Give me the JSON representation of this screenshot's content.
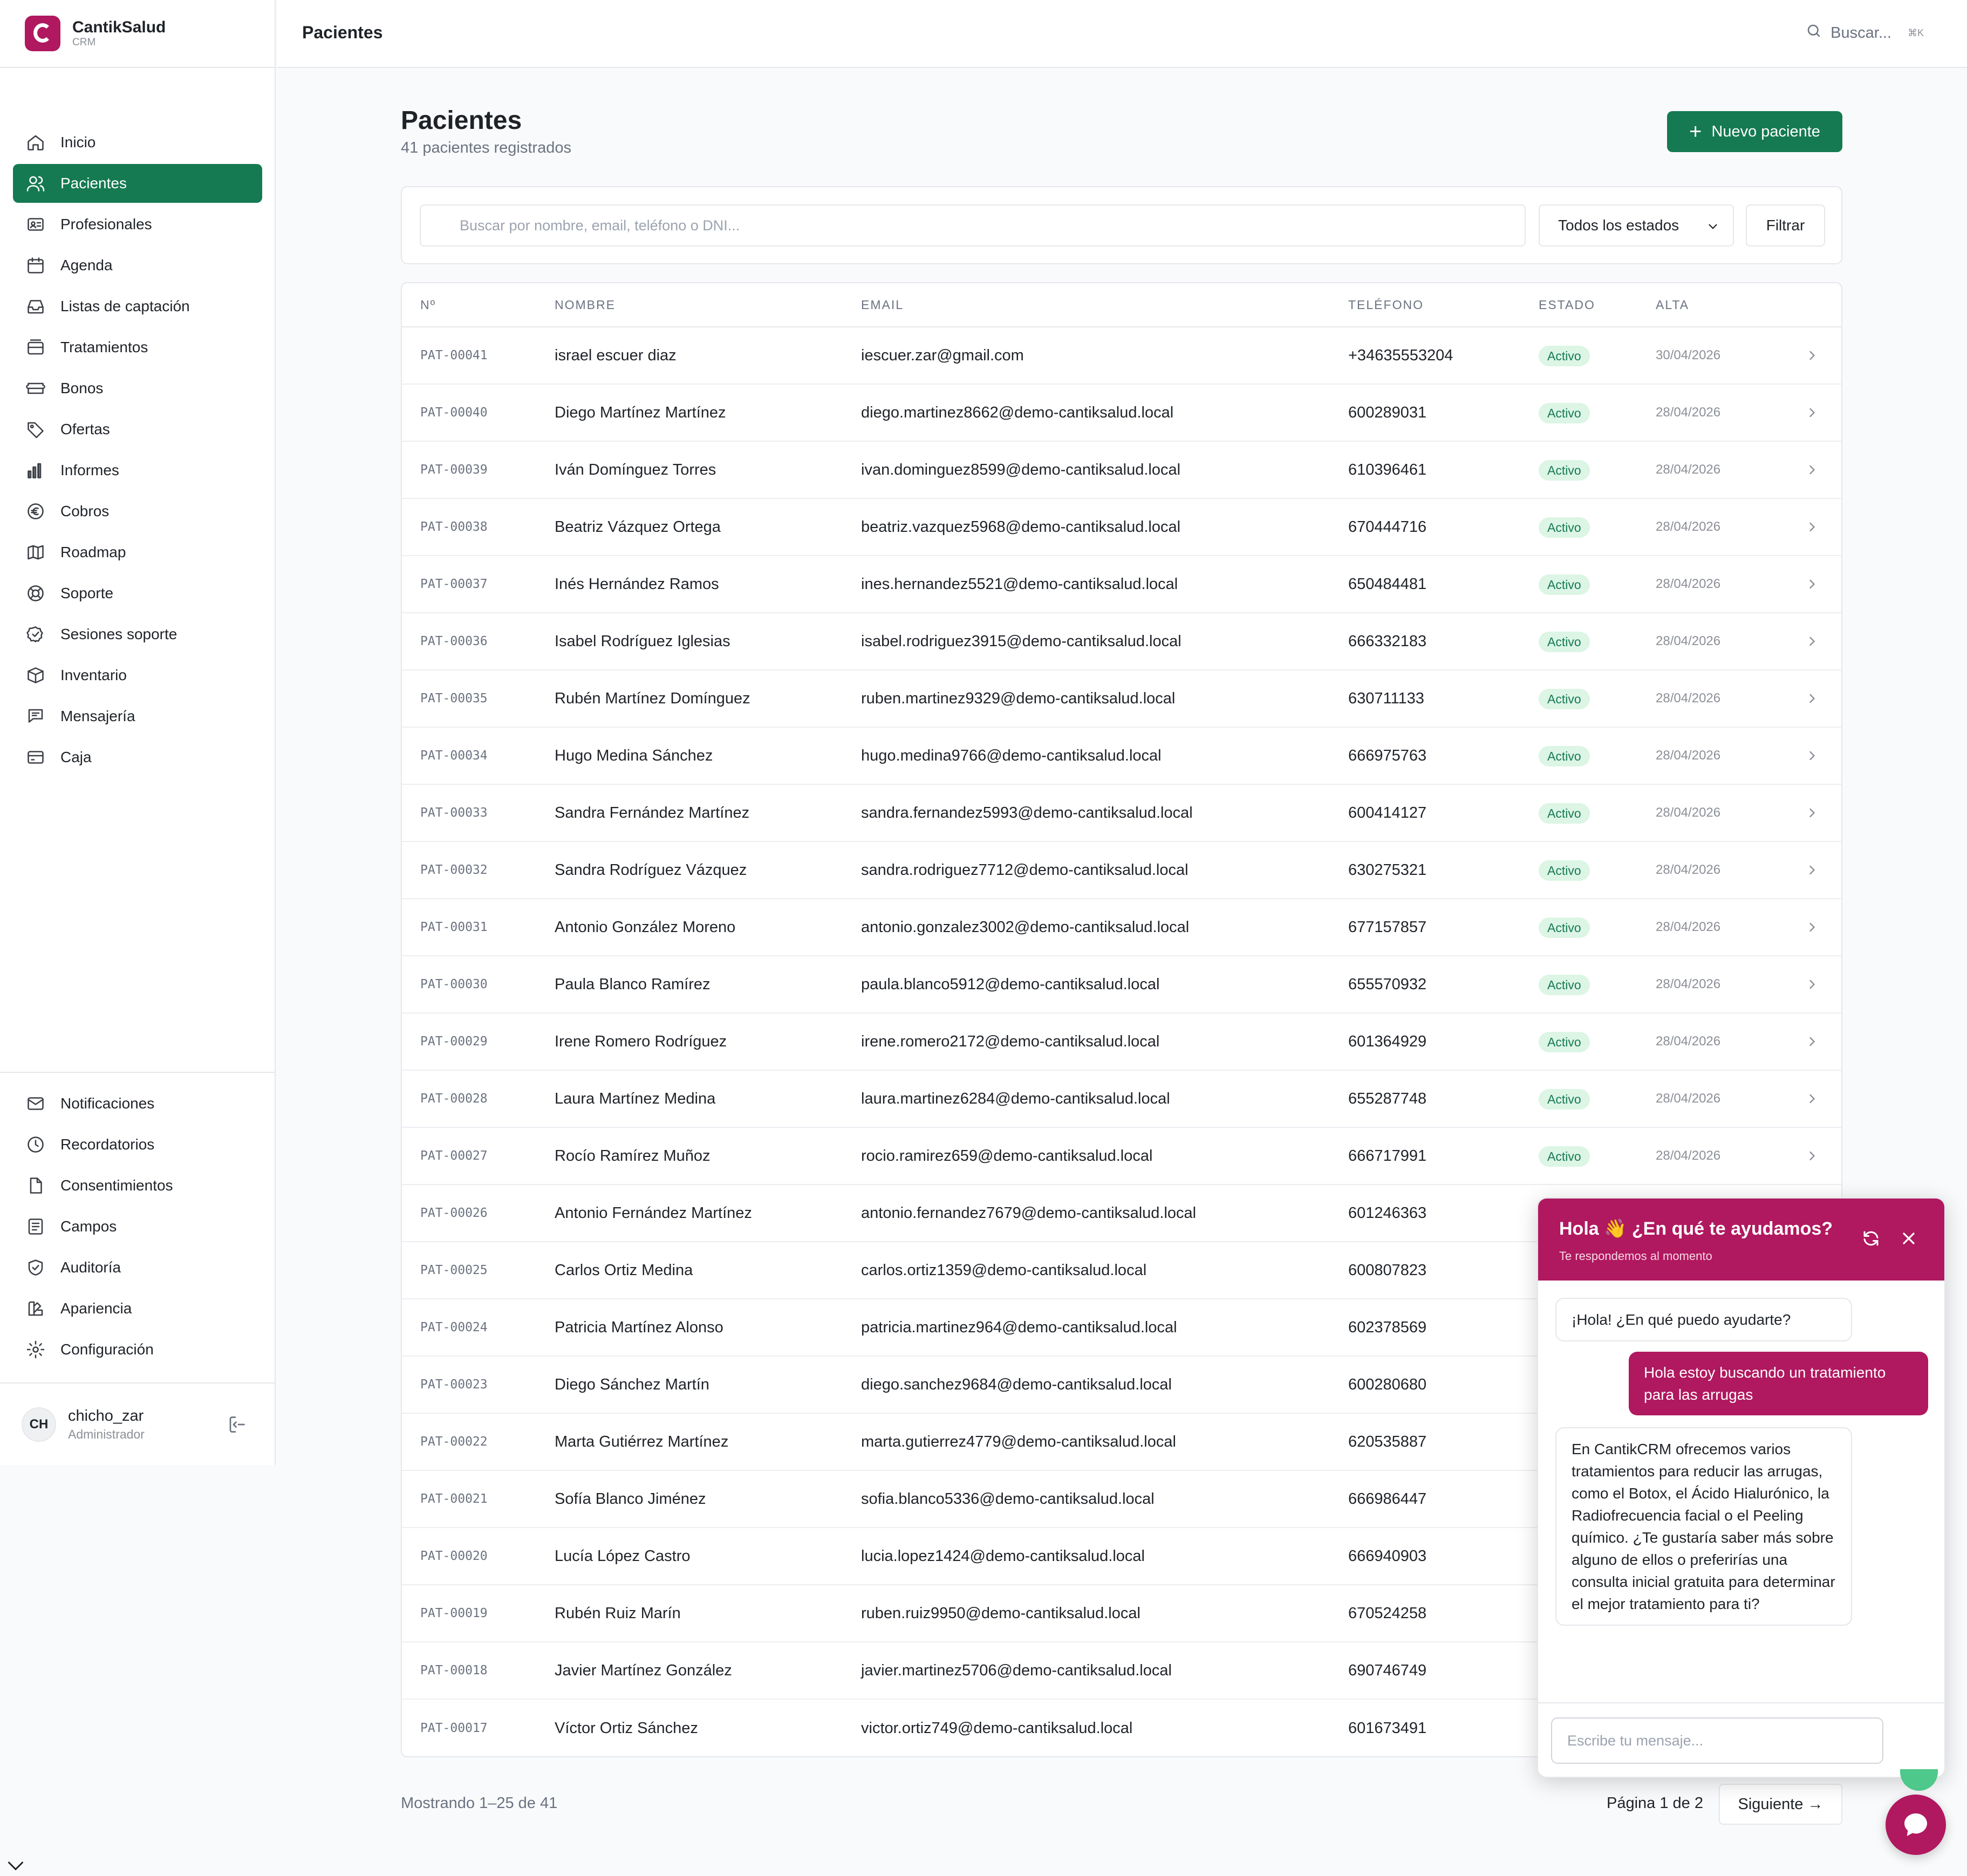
{
  "brand": {
    "name": "CantikSalud",
    "sub": "CRM",
    "color": "#b0185f"
  },
  "topbar": {
    "title": "Pacientes",
    "search_label": "Buscar...",
    "shortcut": "⌘K"
  },
  "nav": [
    {
      "label": "Inicio",
      "icon": "home-icon"
    },
    {
      "label": "Pacientes",
      "icon": "users-icon",
      "active": true
    },
    {
      "label": "Profesionales",
      "icon": "id-card-icon"
    },
    {
      "label": "Agenda",
      "icon": "calendar-icon"
    },
    {
      "label": "Listas de captación",
      "icon": "inbox-icon"
    },
    {
      "label": "Tratamientos",
      "icon": "layers-icon"
    },
    {
      "label": "Bonos",
      "icon": "ticket-icon"
    },
    {
      "label": "Ofertas",
      "icon": "tag-icon"
    },
    {
      "label": "Informes",
      "icon": "bar-chart-icon"
    },
    {
      "label": "Cobros",
      "icon": "euro-icon"
    },
    {
      "label": "Roadmap",
      "icon": "map-icon"
    },
    {
      "label": "Soporte",
      "icon": "lifebuoy-icon"
    },
    {
      "label": "Sesiones soporte",
      "icon": "badge-check-icon"
    },
    {
      "label": "Inventario",
      "icon": "box-icon"
    },
    {
      "label": "Mensajería",
      "icon": "chat-icon"
    },
    {
      "label": "Caja",
      "icon": "wallet-icon"
    }
  ],
  "bottom_nav": [
    {
      "label": "Notificaciones",
      "icon": "mail-icon"
    },
    {
      "label": "Recordatorios",
      "icon": "clock-icon"
    },
    {
      "label": "Consentimientos",
      "icon": "file-icon"
    },
    {
      "label": "Campos",
      "icon": "form-icon"
    },
    {
      "label": "Auditoría",
      "icon": "shield-check-icon"
    },
    {
      "label": "Apariencia",
      "icon": "palette-icon"
    },
    {
      "label": "Configuración",
      "icon": "gear-icon"
    }
  ],
  "user": {
    "initials": "CH",
    "name": "chicho_zar",
    "role": "Administrador"
  },
  "page": {
    "title": "Pacientes",
    "subtitle": "41 pacientes registrados",
    "new_button": "Nuevo paciente"
  },
  "filters": {
    "search_placeholder": "Buscar por nombre, email, teléfono o DNI...",
    "status_value": "Todos los estados",
    "filter_button": "Filtrar"
  },
  "table": {
    "headers": {
      "id": "Nº",
      "name": "NOMBRE",
      "email": "EMAIL",
      "phone": "TELÉFONO",
      "state": "ESTADO",
      "alta": "ALTA"
    },
    "rows": [
      {
        "id": "PAT-00041",
        "name": "israel escuer diaz",
        "email": "iescuer.zar@gmail.com",
        "phone": "+34635553204",
        "state": "Activo",
        "alta": "30/04/2026"
      },
      {
        "id": "PAT-00040",
        "name": "Diego Martínez Martínez",
        "email": "diego.martinez8662@demo-cantiksalud.local",
        "phone": "600289031",
        "state": "Activo",
        "alta": "28/04/2026"
      },
      {
        "id": "PAT-00039",
        "name": "Iván Domínguez Torres",
        "email": "ivan.dominguez8599@demo-cantiksalud.local",
        "phone": "610396461",
        "state": "Activo",
        "alta": "28/04/2026"
      },
      {
        "id": "PAT-00038",
        "name": "Beatriz Vázquez Ortega",
        "email": "beatriz.vazquez5968@demo-cantiksalud.local",
        "phone": "670444716",
        "state": "Activo",
        "alta": "28/04/2026"
      },
      {
        "id": "PAT-00037",
        "name": "Inés Hernández Ramos",
        "email": "ines.hernandez5521@demo-cantiksalud.local",
        "phone": "650484481",
        "state": "Activo",
        "alta": "28/04/2026"
      },
      {
        "id": "PAT-00036",
        "name": "Isabel Rodríguez Iglesias",
        "email": "isabel.rodriguez3915@demo-cantiksalud.local",
        "phone": "666332183",
        "state": "Activo",
        "alta": "28/04/2026"
      },
      {
        "id": "PAT-00035",
        "name": "Rubén Martínez Domínguez",
        "email": "ruben.martinez9329@demo-cantiksalud.local",
        "phone": "630711133",
        "state": "Activo",
        "alta": "28/04/2026"
      },
      {
        "id": "PAT-00034",
        "name": "Hugo Medina Sánchez",
        "email": "hugo.medina9766@demo-cantiksalud.local",
        "phone": "666975763",
        "state": "Activo",
        "alta": "28/04/2026"
      },
      {
        "id": "PAT-00033",
        "name": "Sandra Fernández Martínez",
        "email": "sandra.fernandez5993@demo-cantiksalud.local",
        "phone": "600414127",
        "state": "Activo",
        "alta": "28/04/2026"
      },
      {
        "id": "PAT-00032",
        "name": "Sandra Rodríguez Vázquez",
        "email": "sandra.rodriguez7712@demo-cantiksalud.local",
        "phone": "630275321",
        "state": "Activo",
        "alta": "28/04/2026"
      },
      {
        "id": "PAT-00031",
        "name": "Antonio González Moreno",
        "email": "antonio.gonzalez3002@demo-cantiksalud.local",
        "phone": "677157857",
        "state": "Activo",
        "alta": "28/04/2026"
      },
      {
        "id": "PAT-00030",
        "name": "Paula Blanco Ramírez",
        "email": "paula.blanco5912@demo-cantiksalud.local",
        "phone": "655570932",
        "state": "Activo",
        "alta": "28/04/2026"
      },
      {
        "id": "PAT-00029",
        "name": "Irene Romero Rodríguez",
        "email": "irene.romero2172@demo-cantiksalud.local",
        "phone": "601364929",
        "state": "Activo",
        "alta": "28/04/2026"
      },
      {
        "id": "PAT-00028",
        "name": "Laura Martínez Medina",
        "email": "laura.martinez6284@demo-cantiksalud.local",
        "phone": "655287748",
        "state": "Activo",
        "alta": "28/04/2026"
      },
      {
        "id": "PAT-00027",
        "name": "Rocío Ramírez Muñoz",
        "email": "rocio.ramirez659@demo-cantiksalud.local",
        "phone": "666717991",
        "state": "Activo",
        "alta": "28/04/2026"
      },
      {
        "id": "PAT-00026",
        "name": "Antonio Fernández Martínez",
        "email": "antonio.fernandez7679@demo-cantiksalud.local",
        "phone": "601246363"
      },
      {
        "id": "PAT-00025",
        "name": "Carlos Ortiz Medina",
        "email": "carlos.ortiz1359@demo-cantiksalud.local",
        "phone": "600807823"
      },
      {
        "id": "PAT-00024",
        "name": "Patricia Martínez Alonso",
        "email": "patricia.martinez964@demo-cantiksalud.local",
        "phone": "602378569"
      },
      {
        "id": "PAT-00023",
        "name": "Diego Sánchez Martín",
        "email": "diego.sanchez9684@demo-cantiksalud.local",
        "phone": "600280680"
      },
      {
        "id": "PAT-00022",
        "name": "Marta Gutiérrez Martínez",
        "email": "marta.gutierrez4779@demo-cantiksalud.local",
        "phone": "620535887"
      },
      {
        "id": "PAT-00021",
        "name": "Sofía Blanco Jiménez",
        "email": "sofia.blanco5336@demo-cantiksalud.local",
        "phone": "666986447"
      },
      {
        "id": "PAT-00020",
        "name": "Lucía López Castro",
        "email": "lucia.lopez1424@demo-cantiksalud.local",
        "phone": "666940903"
      },
      {
        "id": "PAT-00019",
        "name": "Rubén Ruiz Marín",
        "email": "ruben.ruiz9950@demo-cantiksalud.local",
        "phone": "670524258"
      },
      {
        "id": "PAT-00018",
        "name": "Javier Martínez González",
        "email": "javier.martinez5706@demo-cantiksalud.local",
        "phone": "690746749"
      },
      {
        "id": "PAT-00017",
        "name": "Víctor Ortiz Sánchez",
        "email": "victor.ortiz749@demo-cantiksalud.local",
        "phone": "601673491"
      }
    ]
  },
  "pagination": {
    "showing": "Mostrando 1–25 de 41",
    "page": "Página 1 de 2",
    "next": "Siguiente →"
  },
  "chat": {
    "title": "Hola 👋 ¿En qué te ayudamos?",
    "subtitle": "Te respondemos al momento",
    "messages": [
      {
        "from": "bot",
        "text": "¡Hola! ¿En qué puedo ayudarte?"
      },
      {
        "from": "user",
        "text": "Hola estoy buscando un tratamiento para las arrugas"
      },
      {
        "from": "bot",
        "text": "En CantikCRM ofrecemos varios tratamientos para reducir las arrugas, como el Botox, el Ácido Hialurónico, la Radiofrecuencia facial o el Peeling químico. ¿Te gustaría saber más sobre alguno de ellos o preferirías una consulta inicial gratuita para determinar el mejor tratamiento para ti?"
      }
    ],
    "input_placeholder": "Escribe tu mensaje..."
  },
  "colors": {
    "primary_green": "#157a52",
    "brand_magenta": "#b0185f",
    "badge_bg": "#dcf5e4"
  }
}
